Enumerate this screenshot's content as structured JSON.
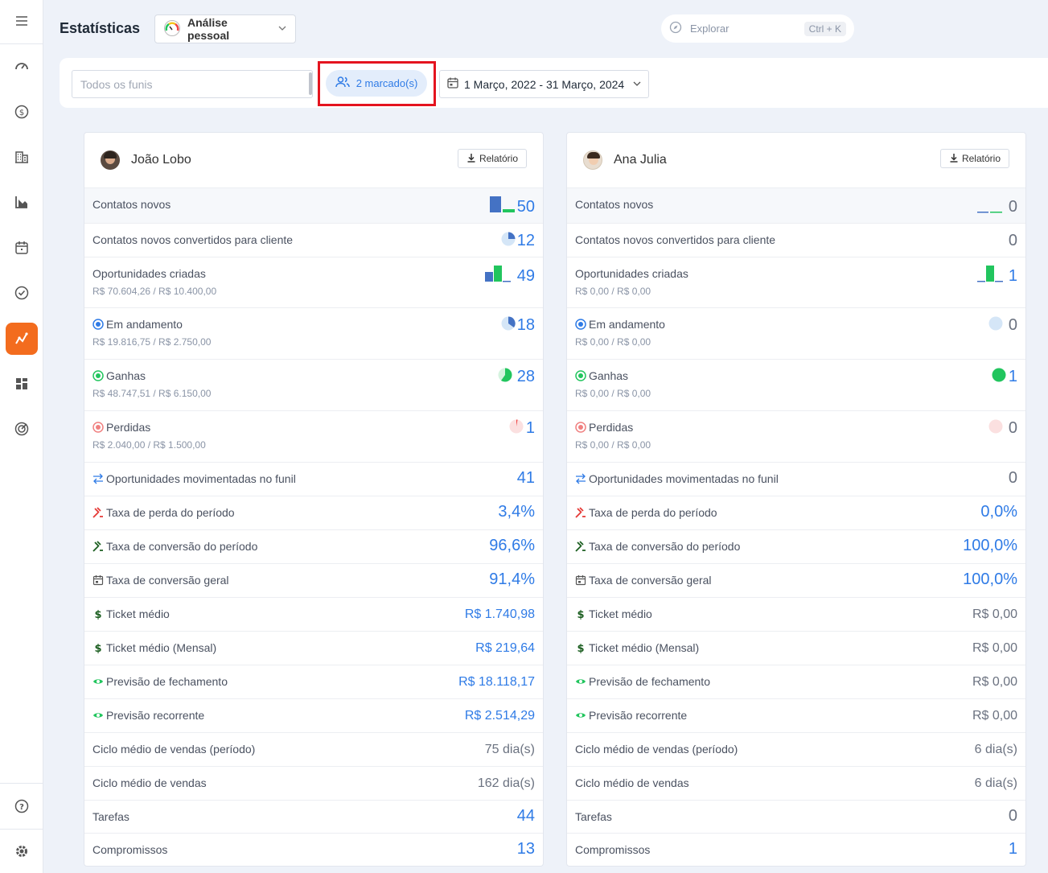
{
  "page": {
    "title": "Estatísticas"
  },
  "analysis_dropdown": {
    "label": "Análise pessoal"
  },
  "search": {
    "placeholder": "Explorar",
    "shortcut": "Ctrl + K"
  },
  "filters": {
    "funnel_placeholder": "Todos os funis",
    "users_chip": "2 marcado(s)",
    "date_range": "1 Março, 2022 - 31 Março, 2024"
  },
  "colors": {
    "accent": "#2f7be6",
    "active_nav": "#f36c1e",
    "highlight": "#e4141f",
    "green": "#22c55e",
    "bar_blue": "#4472c4"
  },
  "sidebar": {
    "icons": [
      "menu-icon",
      "dashboard-icon",
      "dollar-icon",
      "buildings-icon",
      "chart-icon",
      "calendar-icon",
      "check-circle-icon",
      "funnel-stats-icon",
      "widgets-icon",
      "target-icon",
      "help-icon",
      "settings-icon"
    ]
  },
  "cards": [
    {
      "name": "João Lobo",
      "report_label": "Relatório",
      "rows": [
        {
          "label": "Contatos novos",
          "value": "50"
        },
        {
          "label": "Contatos novos convertidos para cliente",
          "value": "12"
        },
        {
          "label": "Oportunidades criadas",
          "sub": "R$ 70.604,26 / R$ 10.400,00",
          "value": "49"
        },
        {
          "label": "Em andamento",
          "sub": "R$ 19.816,75 / R$ 2.750,00",
          "value": "18"
        },
        {
          "label": "Ganhas",
          "sub": "R$ 48.747,51 / R$ 6.150,00",
          "value": "28"
        },
        {
          "label": "Perdidas",
          "sub": "R$ 2.040,00 / R$ 1.500,00",
          "value": "1"
        },
        {
          "label": "Oportunidades movimentadas no funil",
          "value": "41"
        },
        {
          "label": "Taxa de perda do período",
          "value": "3,4%"
        },
        {
          "label": "Taxa de conversão do período",
          "value": "96,6%"
        },
        {
          "label": "Taxa de conversão geral",
          "value": "91,4%"
        },
        {
          "label": "Ticket médio",
          "value": "R$ 1.740,98"
        },
        {
          "label": "Ticket médio (Mensal)",
          "value": "R$ 219,64"
        },
        {
          "label": "Previsão de fechamento",
          "value": "R$ 18.118,17"
        },
        {
          "label": "Previsão recorrente",
          "value": "R$ 2.514,29"
        },
        {
          "label": "Ciclo médio de vendas (período)",
          "value": "75 dia(s)"
        },
        {
          "label": "Ciclo médio de vendas",
          "value": "162 dia(s)"
        },
        {
          "label": "Tarefas",
          "value": "44"
        },
        {
          "label": "Compromissos",
          "value": "13"
        }
      ]
    },
    {
      "name": "Ana Julia",
      "report_label": "Relatório",
      "rows": [
        {
          "label": "Contatos novos",
          "value": "0"
        },
        {
          "label": "Contatos novos convertidos para cliente",
          "value": "0"
        },
        {
          "label": "Oportunidades criadas",
          "sub": "R$ 0,00 / R$ 0,00",
          "value": "1"
        },
        {
          "label": "Em andamento",
          "sub": "R$ 0,00 / R$ 0,00",
          "value": "0"
        },
        {
          "label": "Ganhas",
          "sub": "R$ 0,00 / R$ 0,00",
          "value": "1"
        },
        {
          "label": "Perdidas",
          "sub": "R$ 0,00 / R$ 0,00",
          "value": "0"
        },
        {
          "label": "Oportunidades movimentadas no funil",
          "value": "0"
        },
        {
          "label": "Taxa de perda do período",
          "value": "0,0%"
        },
        {
          "label": "Taxa de conversão do período",
          "value": "100,0%"
        },
        {
          "label": "Taxa de conversão geral",
          "value": "100,0%"
        },
        {
          "label": "Ticket médio",
          "value": "R$ 0,00"
        },
        {
          "label": "Ticket médio (Mensal)",
          "value": "R$ 0,00"
        },
        {
          "label": "Previsão de fechamento",
          "value": "R$ 0,00"
        },
        {
          "label": "Previsão recorrente",
          "value": "R$ 0,00"
        },
        {
          "label": "Ciclo médio de vendas (período)",
          "value": "6 dia(s)"
        },
        {
          "label": "Ciclo médio de vendas",
          "value": "6 dia(s)"
        },
        {
          "label": "Tarefas",
          "value": "0"
        },
        {
          "label": "Compromissos",
          "value": "1"
        }
      ]
    }
  ]
}
